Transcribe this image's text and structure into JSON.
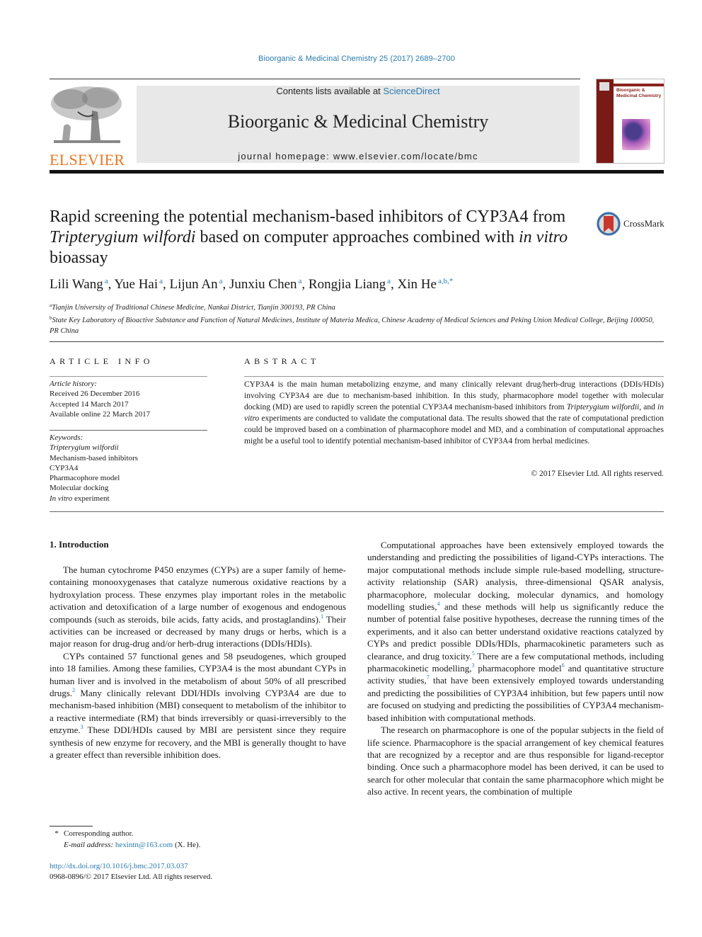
{
  "running_head": "Bioorganic & Medicinal Chemistry 25 (2017) 2689–2700",
  "masthead": {
    "publisher_logo_text": "ELSEVIER",
    "contents_prefix": "Contents lists available at ",
    "contents_link": "ScienceDirect",
    "journal_name": "Bioorganic & Medicinal Chemistry",
    "homepage_prefix": "journal homepage: ",
    "homepage_url": "www.elsevier.com/locate/bmc",
    "cover_title": "Bioorganic & Medicinal Chemistry",
    "colors": {
      "elsevier_orange": "#e87722",
      "link_blue": "#2a7ab0",
      "cover_red": "#8b2320",
      "masthead_gray": "#e8e8e8"
    }
  },
  "article": {
    "title_parts": [
      {
        "text": "Rapid screening the potential mechanism-based inhibitors of CYP3A4 from ",
        "italic": false
      },
      {
        "text": "Tripterygium wilfordi",
        "italic": true
      },
      {
        "text": " based on computer approaches combined with ",
        "italic": false
      },
      {
        "text": "in vitro",
        "italic": true
      },
      {
        "text": " bioassay",
        "italic": false
      }
    ],
    "crossmark_label": "CrossMark",
    "authors": [
      {
        "name": "Lili Wang",
        "sup": "a"
      },
      {
        "name": "Yue Hai",
        "sup": "a"
      },
      {
        "name": "Lijun An",
        "sup": "a"
      },
      {
        "name": "Junxiu Chen",
        "sup": "a"
      },
      {
        "name": "Rongjia Liang",
        "sup": "a"
      },
      {
        "name": "Xin He",
        "sup": "a,b,*"
      }
    ],
    "affiliations": [
      {
        "key": "a",
        "text": "Tianjin University of Traditional Chinese Medicine, Nankai District, Tianjin 300193, PR China"
      },
      {
        "key": "b",
        "text": "State Key Laboratory of Bioactive Substance and Function of Natural Medicines, Institute of Materia Medica, Chinese Academy of Medical Sciences and Peking Union Medical College, Beijing 100050, PR China"
      }
    ]
  },
  "article_info": {
    "heading": "ARTICLE INFO",
    "history_label": "Article history:",
    "history": [
      "Received 26 December 2016",
      "Accepted 14 March 2017",
      "Available online 22 March 2017"
    ],
    "keywords_label": "Keywords:",
    "keywords": [
      {
        "text": "Tripterygium wilfordii",
        "italic_prefix": "Tripterygium wilfordii",
        "rest": ""
      },
      {
        "text": "Mechanism-based inhibitors",
        "italic_prefix": "",
        "rest": "Mechanism-based inhibitors"
      },
      {
        "text": "CYP3A4",
        "italic_prefix": "",
        "rest": "CYP3A4"
      },
      {
        "text": "Pharmacophore model",
        "italic_prefix": "",
        "rest": "Pharmacophore model"
      },
      {
        "text": "Molecular docking",
        "italic_prefix": "",
        "rest": "Molecular docking"
      },
      {
        "text": "In vitro experiment",
        "italic_prefix": "In vitro",
        "rest": " experiment"
      }
    ]
  },
  "abstract": {
    "heading": "ABSTRACT",
    "parts": [
      {
        "text": "CYP3A4 is the main human metabolizing enzyme, and many clinically relevant drug/herb-drug interactions (DDIs/HDIs) involving CYP3A4 are due to mechanism-based inhibition. In this study, pharmacophore model together with molecular docking (MD) are used to rapidly screen the potential CYP3A4 mechanism-based inhibitors from ",
        "italic": false
      },
      {
        "text": "Tripterygium wilfordii",
        "italic": true
      },
      {
        "text": ", and ",
        "italic": false
      },
      {
        "text": "in vitro",
        "italic": true
      },
      {
        "text": " experiments are conducted to validate the computational data. The results showed that the rate of computational prediction could be improved based on a combination of pharmacophore model and MD, and a combination of computational approaches might be a useful tool to identify potential mechanism-based inhibitor of CYP3A4 from herbal medicines.",
        "italic": false
      }
    ],
    "copyright": "© 2017 Elsevier Ltd. All rights reserved."
  },
  "body": {
    "section_heading": "1. Introduction",
    "left_paragraphs": [
      [
        {
          "text": "The human cytochrome P450 enzymes (CYPs) are a super family of heme-containing monooxygenases that catalyze numerous oxidative reactions by a hydroxylation process. These enzymes play important roles in the metabolic activation and detoxification of a large number of exogenous and endogenous compounds (such as steroids, bile acids, fatty acids, and prostaglandins)."
        },
        {
          "ref": "1"
        },
        {
          "text": " Their activities can be increased or decreased by many drugs or herbs, which is a major reason for drug-drug and/or herb-drug interactions (DDIs/HDIs)."
        }
      ],
      [
        {
          "text": "CYPs contained 57 functional genes and 58 pseudogenes, which grouped into 18 families. Among these families, CYP3A4 is the most abundant CYPs in human liver and is involved in the metabolism of about 50% of all prescribed drugs."
        },
        {
          "ref": "2"
        },
        {
          "text": " Many clinically relevant DDI/HDIs involving CYP3A4 are due to mechanism-based inhibition (MBI) consequent to metabolism of the inhibitor to a reactive intermediate (RM) that binds irreversibly or quasi-irreversibly to the enzyme."
        },
        {
          "ref": "3"
        },
        {
          "text": " These DDI/HDIs caused by MBI are persistent since they require synthesis of new enzyme for recovery, and the MBI is generally thought to have a greater effect than reversible inhibition does."
        }
      ]
    ],
    "right_paragraphs": [
      [
        {
          "text": "Computational approaches have been extensively employed towards the understanding and predicting the possibilities of ligand-CYPs interactions. The major computational methods include simple rule-based modelling, structure-activity relationship (SAR) analysis, three-dimensional QSAR analysis, pharmacophore, molecular docking, molecular dynamics, and homology modelling studies,"
        },
        {
          "ref": "4"
        },
        {
          "text": " and these methods will help us significantly reduce the number of potential false positive hypotheses, decrease the running times of the experiments, and it also can better understand oxidative reactions catalyzed by CYPs and predict possible DDIs/HDIs, pharmacokinetic parameters such as clearance, and drug toxicity."
        },
        {
          "ref": "5"
        },
        {
          "text": " There are a few computational methods, including pharmacokinetic modelling,"
        },
        {
          "ref": "3"
        },
        {
          "text": " pharmacophore model"
        },
        {
          "ref": "6"
        },
        {
          "text": " and quantitative structure activity studies,"
        },
        {
          "ref": "7"
        },
        {
          "text": " that have been extensively employed towards understanding and predicting the possibilities of CYP3A4 inhibition, but few papers until now are focused on studying and predicting the possibilities of CYP3A4 mechanism-based inhibition with computational methods."
        }
      ],
      [
        {
          "text": "The research on pharmacophore is one of the popular subjects in the field of life science. Pharmacophore is the spacial arrangement of key chemical features that are recognized by a receptor and are thus responsible for ligand-receptor binding. Once such a pharmacophore model has been derived, it can be used to search for other molecular that contain the same pharmacophore which might be also active. In recent years, the combination of multiple"
        }
      ]
    ]
  },
  "footnotes": {
    "corresponding_marker": "*",
    "corresponding_text": "Corresponding author.",
    "email_label": "E-mail address: ",
    "email": "hexintn@163.com",
    "email_suffix": " (X. He).",
    "doi_link": "http://dx.doi.org/10.1016/j.bmc.2017.03.037",
    "issn_line": "0968-0896/© 2017 Elsevier Ltd. All rights reserved."
  }
}
